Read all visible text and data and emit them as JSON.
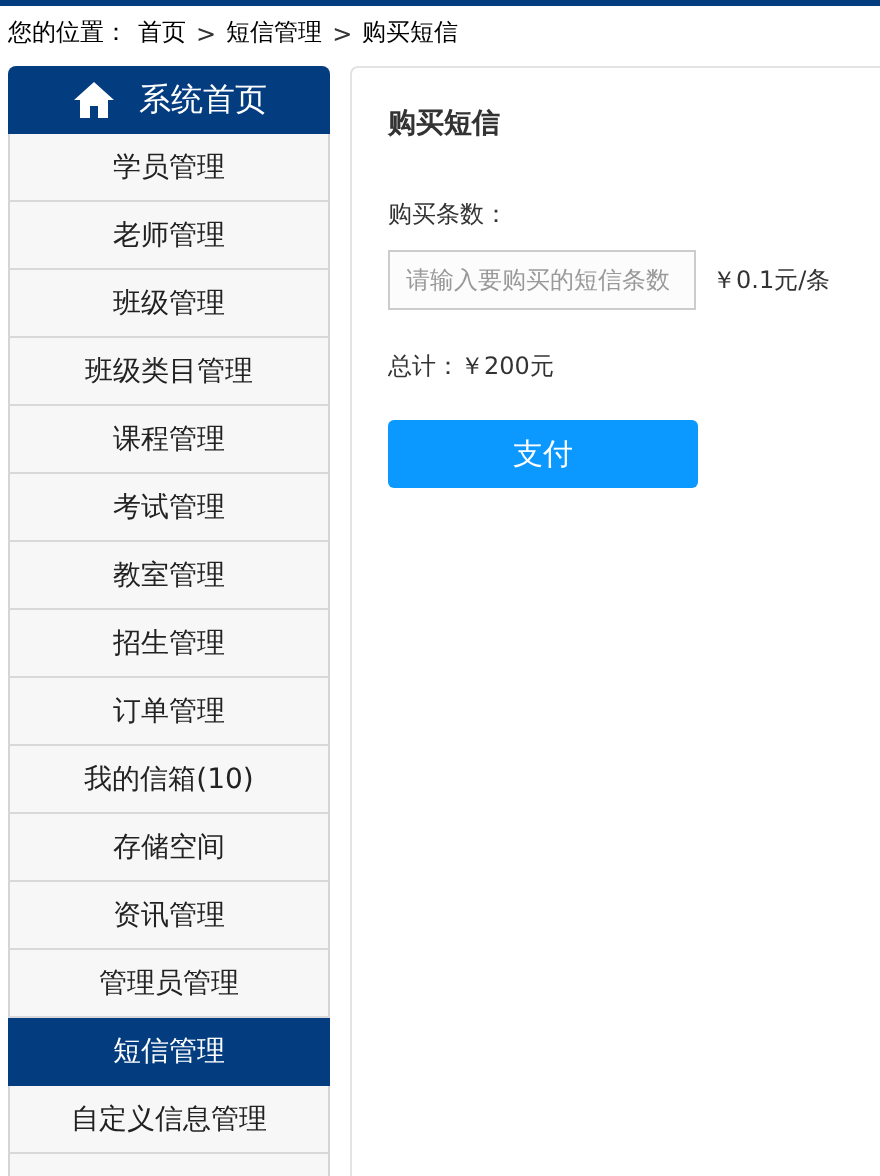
{
  "breadcrumb": {
    "label": "您的位置：",
    "items": [
      {
        "text": "首页"
      },
      {
        "separator": ">",
        "text": "短信管理"
      },
      {
        "separator": ">",
        "text": "购买短信"
      }
    ]
  },
  "sidebar": {
    "header": "系统首页",
    "items": [
      {
        "label": "学员管理",
        "selected": false
      },
      {
        "label": "老师管理",
        "selected": false
      },
      {
        "label": "班级管理",
        "selected": false
      },
      {
        "label": "班级类目管理",
        "selected": false
      },
      {
        "label": "课程管理",
        "selected": false
      },
      {
        "label": "考试管理",
        "selected": false
      },
      {
        "label": "教室管理",
        "selected": false
      },
      {
        "label": "招生管理",
        "selected": false
      },
      {
        "label": "订单管理",
        "selected": false
      },
      {
        "label": "我的信箱(10)",
        "selected": false
      },
      {
        "label": "存储空间",
        "selected": false
      },
      {
        "label": "资讯管理",
        "selected": false
      },
      {
        "label": "管理员管理",
        "selected": false
      },
      {
        "label": "短信管理",
        "selected": true
      },
      {
        "label": "自定义信息管理",
        "selected": false
      }
    ]
  },
  "panel": {
    "title": "购买短信",
    "quantity_label": "购买条数：",
    "quantity_field": {
      "placeholder": "请输入要购买的短信条数"
    },
    "unit_price": "￥0.1元/条",
    "total": "总计：￥200元",
    "pay_button": "支付"
  }
}
